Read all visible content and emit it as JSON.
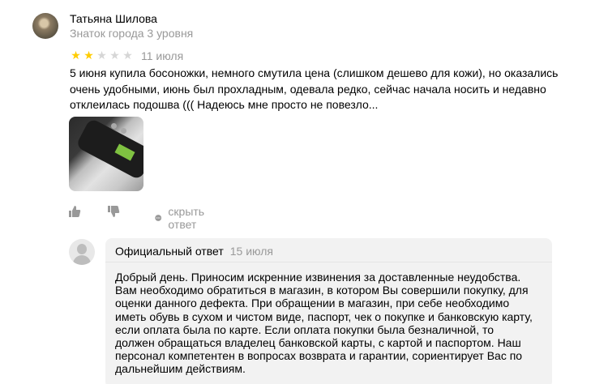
{
  "review": {
    "author_name": "Татьяна Шилова",
    "author_level": "Знаток города 3 уровня",
    "rating": 2,
    "rating_max": 5,
    "date": "11 июля",
    "text": "5 июня купила босоножки, немного смутила цена (слишком дешево для кожи), но оказались очень удобными, июнь был прохладным, одевала редко, сейчас начала носить и недавно отклеилась подошва ((( Надеюсь мне просто не повезло...",
    "photo_icon": "sandal-photo-thumbnail"
  },
  "actions": {
    "like_icon": "thumbs-up-icon",
    "dislike_icon": "thumbs-down-icon",
    "hide_answer_label": "скрыть ответ"
  },
  "official_answer": {
    "title": "Официальный ответ",
    "date": "15 июля",
    "text": "Добрый день. Приносим искренние извинения за доставленные неудобства. Вам необходимо обратиться в магазин, в котором Вы совершили покупку, для оценки данного дефекта. При обращении в магазин, при себе необходимо иметь обувь в сухом и чистом виде, паспорт, чек о покупке и банковскую карту, если оплата была по карте. Если оплата покупки была безналичной, то должен обращаться владелец банковской карты, с картой и паспортом. Наш персонал компетентен в вопросах возврата и гарантии, сориентирует Вас по дальнейшим действиям."
  },
  "colors": {
    "star_on": "#ffcc00",
    "star_off": "#d6d6d6",
    "muted_text": "#999999",
    "answer_bg": "#f2f2f2"
  }
}
